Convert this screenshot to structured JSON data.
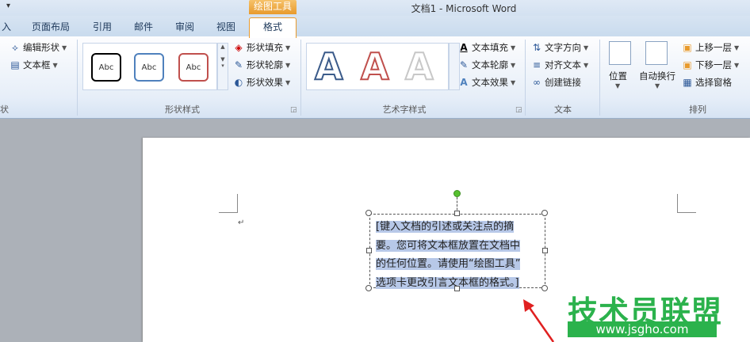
{
  "window": {
    "title": "文档1  -  Microsoft Word",
    "context_tab_group": "绘图工具"
  },
  "tabs": [
    {
      "label": "入"
    },
    {
      "label": "页面布局"
    },
    {
      "label": "引用"
    },
    {
      "label": "邮件"
    },
    {
      "label": "审阅"
    },
    {
      "label": "视图"
    }
  ],
  "active_tab": "格式",
  "ribbon": {
    "insert_shapes": {
      "edit_shape": "编辑形状",
      "text_box": "文本框",
      "group_label": "状"
    },
    "shape_styles": {
      "gallery": [
        "Abc",
        "Abc",
        "Abc"
      ],
      "fill": "形状填充",
      "outline": "形状轮廓",
      "effects": "形状效果",
      "group_label": "形状样式"
    },
    "wordart_styles": {
      "letters": [
        "A",
        "A",
        "A"
      ],
      "text_fill": "文本填充",
      "text_outline": "文本轮廓",
      "text_effects": "文本效果",
      "group_label": "艺术字样式"
    },
    "text": {
      "direction": "文字方向",
      "align": "对齐文本",
      "link": "创建链接",
      "group_label": "文本"
    },
    "arrange": {
      "position": "位置",
      "wrap": "自动换行",
      "bring_forward": "上移一层",
      "send_backward": "下移一层",
      "selection_pane": "选择窗格",
      "group_label": "排列"
    }
  },
  "document": {
    "paragraph_mark": "↵",
    "textbox_lines": [
      "[键入文档的引述或关注点的摘",
      "要。您可将文本框放置在文档中",
      "的任何位置。请使用“绘图工具”",
      "选项卡更改引言文本框的格式。]"
    ]
  },
  "watermark": {
    "title": "技术员联盟",
    "url": "www.jsgho.com"
  },
  "colors": {
    "context_tab": "#e89a2c",
    "selection_highlight": "#b7c8e8",
    "watermark_green": "#2bb24c",
    "arrow_red": "#e02020"
  }
}
